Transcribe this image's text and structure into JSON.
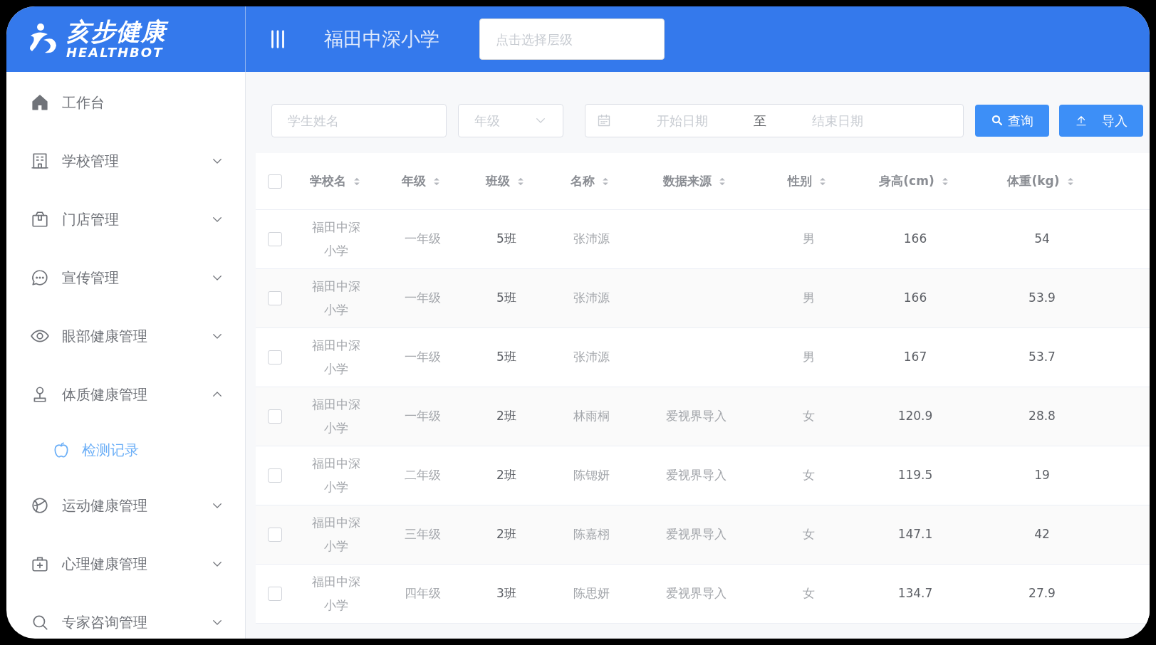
{
  "logo": {
    "title": "亥步健康",
    "subtitle": "HEALTHBOT"
  },
  "header": {
    "school": "福田中深小学",
    "level_select": {
      "placeholder": "点击选择层级"
    }
  },
  "sidebar": {
    "items": [
      {
        "label": "工作台",
        "kind": "link"
      },
      {
        "label": "学校管理",
        "kind": "group",
        "expanded": false
      },
      {
        "label": "门店管理",
        "kind": "group",
        "expanded": false
      },
      {
        "label": "宣传管理",
        "kind": "group",
        "expanded": false
      },
      {
        "label": "眼部健康管理",
        "kind": "group",
        "expanded": false
      },
      {
        "label": "体质健康管理",
        "kind": "group",
        "expanded": true,
        "children": [
          {
            "label": "检测记录",
            "selected": true
          }
        ]
      },
      {
        "label": "运动健康管理",
        "kind": "group",
        "expanded": false
      },
      {
        "label": "心理健康管理",
        "kind": "group",
        "expanded": false
      },
      {
        "label": "专家咨询管理",
        "kind": "group",
        "expanded": false
      }
    ]
  },
  "filters": {
    "name": {
      "placeholder": "学生姓名"
    },
    "grade": {
      "placeholder": "年级"
    },
    "date_range": {
      "start_placeholder": "开始日期",
      "separator": "至",
      "end_placeholder": "结束日期"
    },
    "buttons": [
      {
        "label": "查询",
        "kind": "search"
      },
      {
        "label": "导入",
        "kind": "upload"
      }
    ]
  },
  "table": {
    "select_all": false,
    "columns": [
      "学校名",
      "年级",
      "班级",
      "名称",
      "数据来源",
      "性别",
      "身高(cm)",
      "体重(kg)"
    ],
    "rows": [
      {
        "checked": false,
        "cells": [
          "福田中深小学",
          "一年级",
          "5班",
          "张沛源",
          "",
          "男",
          "166",
          "54"
        ]
      },
      {
        "checked": false,
        "cells": [
          "福田中深小学",
          "一年级",
          "5班",
          "张沛源",
          "",
          "男",
          "166",
          "53.9"
        ]
      },
      {
        "checked": false,
        "cells": [
          "福田中深小学",
          "一年级",
          "5班",
          "张沛源",
          "",
          "男",
          "167",
          "53.7"
        ]
      },
      {
        "checked": false,
        "cells": [
          "福田中深小学",
          "一年级",
          "2班",
          "林雨桐",
          "爱视界导入",
          "女",
          "120.9",
          "28.8"
        ]
      },
      {
        "checked": false,
        "cells": [
          "福田中深小学",
          "二年级",
          "2班",
          "陈锶妍",
          "爱视界导入",
          "女",
          "119.5",
          "19"
        ]
      },
      {
        "checked": false,
        "cells": [
          "福田中深小学",
          "三年级",
          "2班",
          "陈嘉栩",
          "爱视界导入",
          "女",
          "147.1",
          "42"
        ]
      },
      {
        "checked": false,
        "cells": [
          "福田中深小学",
          "四年级",
          "3班",
          "陈思妍",
          "爱视界导入",
          "女",
          "134.7",
          "27.9"
        ]
      }
    ]
  }
}
